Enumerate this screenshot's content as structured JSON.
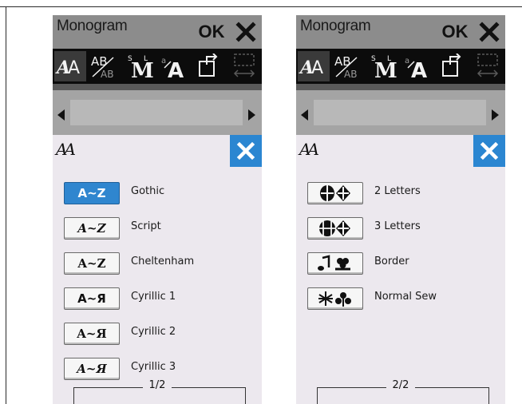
{
  "left_panel": {
    "title": "Monogram",
    "ok_label": "OK",
    "sub_icon": "AA",
    "rows": [
      {
        "swatch": "A~Z",
        "label": "Gothic",
        "selected": true
      },
      {
        "swatch": "A~Z",
        "label": "Script",
        "selected": false
      },
      {
        "swatch": "A~Z",
        "label": "Cheltenham",
        "selected": false
      },
      {
        "swatch": "A~Я",
        "label": "Cyrillic 1",
        "selected": false
      },
      {
        "swatch": "A~Я",
        "label": "Cyrillic 2",
        "selected": false
      },
      {
        "swatch": "A~Я",
        "label": "Cyrillic 3",
        "selected": false
      }
    ],
    "page": "1/2"
  },
  "right_panel": {
    "title": "Monogram",
    "ok_label": "OK",
    "sub_icon": "AA",
    "rows": [
      {
        "swatch": "2-letter-monogram-icon",
        "label": "2 Letters"
      },
      {
        "swatch": "3-letter-monogram-icon",
        "label": "3 Letters"
      },
      {
        "swatch": "border-icon",
        "label": "Border"
      },
      {
        "swatch": "normal-sew-icon",
        "label": "Normal Sew"
      }
    ],
    "page": "2/2"
  },
  "toolbar_icons": [
    "font-style-icon",
    "vertical-text-icon",
    "mirror-icon",
    "size-icon",
    "edit-icon",
    "layout-icon"
  ],
  "colors": {
    "accent": "#2b86d1",
    "title_bar": "#8c8c8c",
    "toolbar": "#0c0c0c",
    "nav_bar": "#a4a4a4",
    "panel_bg": "#ece8ee"
  }
}
